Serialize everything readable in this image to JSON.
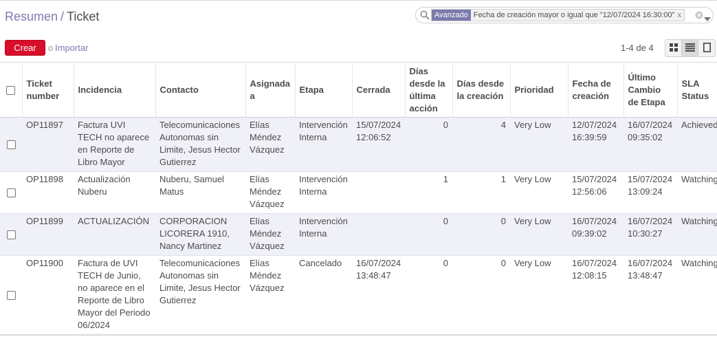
{
  "breadcrumb": {
    "parent": "Resumen",
    "separator": "/",
    "current": "Ticket"
  },
  "search": {
    "facet_label": "Avanzado",
    "facet_value": "Fecha de creación mayor o igual que \"12/07/2024 16:30:00\"",
    "facet_remove": "x",
    "placeholder": ""
  },
  "toolbar": {
    "create_label": "Crear",
    "or_label": "o",
    "import_label": "Importar"
  },
  "pager": {
    "range": "1-4 de 4"
  },
  "table": {
    "columns": [
      "Ticket number",
      "Incidencia",
      "Contacto",
      "Asignada a",
      "Etapa",
      "Cerrada",
      "Días desde la última acción",
      "Días desde la creación",
      "Prioridad",
      "Fecha de creación",
      "Último Cambio de Etapa",
      "SLA Status"
    ],
    "rows": [
      {
        "ticket": "OP11897",
        "incidencia": "Factura UVI TECH no aparece en Reporte de Libro Mayor",
        "contacto": "Telecomunicaciones Autonomas sin Limite, Jesus Hector Gutierrez",
        "asignada": "Elías Méndez Vázquez",
        "etapa": "Intervención Interna",
        "cerrada": "15/07/2024 12:06:52",
        "dias_ultima": "0",
        "dias_creacion": "4",
        "prioridad": "Very Low",
        "fecha_creacion": "12/07/2024 16:39:59",
        "ultimo_cambio": "16/07/2024 09:35:02",
        "sla": "Achieved"
      },
      {
        "ticket": "OP11898",
        "incidencia": "Actualización Nuberu",
        "contacto": "Nuberu, Samuel Matus",
        "asignada": "Elías Méndez Vázquez",
        "etapa": "Intervención Interna",
        "cerrada": "",
        "dias_ultima": "1",
        "dias_creacion": "1",
        "prioridad": "Very Low",
        "fecha_creacion": "15/07/2024 12:56:06",
        "ultimo_cambio": "15/07/2024 13:09:24",
        "sla": "Watching"
      },
      {
        "ticket": "OP11899",
        "incidencia": "ACTUALIZACIÓN",
        "contacto": "CORPORACION LICORERA 1910, Nancy Martinez",
        "asignada": "Elías Méndez Vázquez",
        "etapa": "Intervención Interna",
        "cerrada": "",
        "dias_ultima": "0",
        "dias_creacion": "0",
        "prioridad": "Very Low",
        "fecha_creacion": "16/07/2024 09:39:02",
        "ultimo_cambio": "16/07/2024 10:30:27",
        "sla": "Watching"
      },
      {
        "ticket": "OP11900",
        "incidencia": "Factura de UVI TECH de Junio, no aparece en el Reporte de Libro Mayor del Periodo 06/2024",
        "contacto": "Telecomunicaciones Autonomas sin Limite, Jesus Hector Gutierrez",
        "asignada": "Elías Méndez Vázquez",
        "etapa": "Cancelado",
        "cerrada": "16/07/2024 13:48:47",
        "dias_ultima": "0",
        "dias_creacion": "0",
        "prioridad": "Very Low",
        "fecha_creacion": "16/07/2024 12:08:15",
        "ultimo_cambio": "16/07/2024 13:48:47",
        "sla": "Watching"
      }
    ]
  },
  "icons": {
    "search": "search-icon",
    "clear": "clear-icon",
    "dropdown": "caret-down-icon",
    "kanban": "kanban-view-icon",
    "list": "list-view-icon",
    "form": "form-view-icon"
  },
  "colors": {
    "brand": "#7c7bad",
    "create_button": "#d90e2a",
    "odd_row": "#f0f0f8"
  }
}
